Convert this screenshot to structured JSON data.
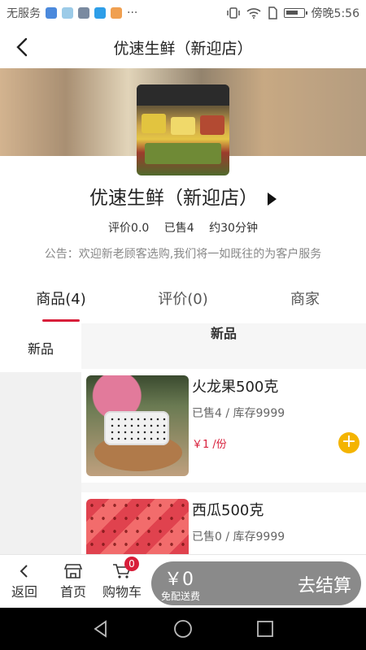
{
  "status_bar": {
    "carrier": "无服务",
    "more": "···",
    "time": "傍晚5:56"
  },
  "nav": {
    "title": "优速生鲜（新迎店）"
  },
  "store": {
    "name": "优速生鲜（新迎店）",
    "rating": "评价0.0",
    "sold": "已售4",
    "delivery_time": "约30分钟",
    "notice": "公告：欢迎新老顾客选购,我们将一如既往的为客户服务"
  },
  "tabs": [
    {
      "label": "商品(4)"
    },
    {
      "label": "评价(0)"
    },
    {
      "label": "商家"
    }
  ],
  "categories": [
    {
      "label": "新品"
    }
  ],
  "list_header": "新品",
  "products": [
    {
      "name": "火龙果500克",
      "sales": "已售4 / 库存9999",
      "price": "￥1 /份"
    },
    {
      "name": "西瓜500克",
      "sales": "已售0 / 库存9999",
      "price": ""
    }
  ],
  "bottom": {
    "back_label": "返回",
    "home_label": "首页",
    "cart_label": "购物车",
    "cart_count": "0",
    "amount": "￥0",
    "delivery_note": "免配送费",
    "checkout_label": "去结算"
  },
  "colors": {
    "accent": "#d81e3a",
    "add_button": "#f4b400",
    "checkout_bg": "#8a8a8a"
  }
}
